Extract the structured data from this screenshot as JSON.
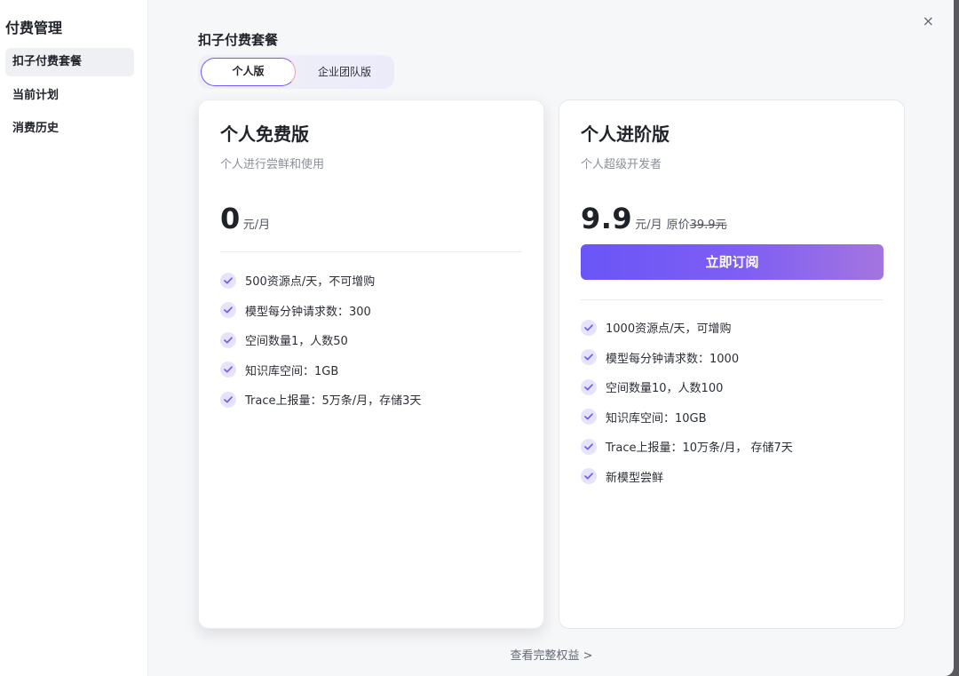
{
  "sidebar": {
    "title": "付费管理",
    "items": [
      {
        "label": "扣子付费套餐",
        "active": true
      },
      {
        "label": "当前计划",
        "active": false
      },
      {
        "label": "消费历史",
        "active": false
      }
    ]
  },
  "main": {
    "close_label": "×",
    "section_title": "扣子付费套餐",
    "tabs": [
      {
        "label": "个人版",
        "active": true
      },
      {
        "label": "企业团队版",
        "active": false
      }
    ],
    "plans": {
      "free": {
        "name": "个人免费版",
        "description": "个人进行尝鲜和使用",
        "price": "0",
        "unit": "元/月",
        "features": [
          "500资源点/天，不可增购",
          "模型每分钟请求数：300",
          "空间数量1，人数50",
          "知识库空间：1GB",
          "Trace上报量：5万条/月，存储3天"
        ]
      },
      "pro": {
        "name": "个人进阶版",
        "description": "个人超级开发者",
        "price": "9.9",
        "unit": "元/月",
        "original_label": "原价",
        "original_price": "39.9元",
        "subscribe_label": "立即订阅",
        "features": [
          "1000资源点/天，可增购",
          "模型每分钟请求数：1000",
          "空间数量10，人数100",
          "知识库空间：10GB",
          "Trace上报量：10万条/月， 存储7天",
          "新模型尝鲜"
        ]
      }
    },
    "footer_link": "查看完整权益 >"
  },
  "colors": {
    "accent": "#6d5cf6",
    "check_bg": "#e6e3fd",
    "check_icon": "#6d5cf6"
  },
  "icons": {
    "close": "close-icon",
    "check": "check-circle-icon"
  }
}
